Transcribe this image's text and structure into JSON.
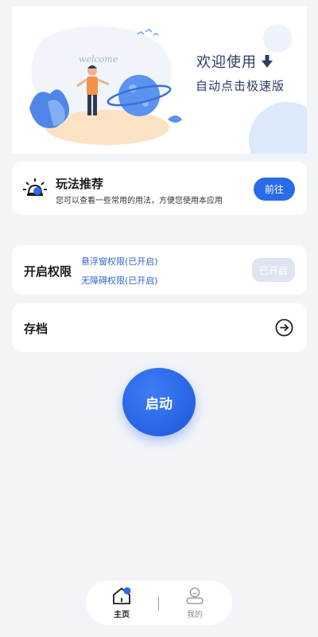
{
  "banner": {
    "welcome_text": "welcome",
    "title": "欢迎使用",
    "subtitle": "自动点击极速版",
    "title_icon": "arrow-down-icon"
  },
  "tips_card": {
    "icon": "lightbulb-icon",
    "title": "玩法推荐",
    "description": "您可以查看一些常用的用法，方便您使用本应用",
    "button_label": "前往"
  },
  "permissions_card": {
    "title": "开启权限",
    "lines": [
      "悬浮窗权限(已开启)",
      "无障碍权限(已开启)"
    ],
    "button_label": "已开启"
  },
  "archive_card": {
    "title": "存档",
    "icon": "arrow-right-circle-icon"
  },
  "start_button": {
    "label": "启动"
  },
  "bottom_nav": {
    "items": [
      {
        "label": "主页",
        "icon": "home-icon",
        "active": true
      },
      {
        "label": "我的",
        "icon": "profile-icon",
        "active": false
      }
    ]
  },
  "colors": {
    "accent": "#2b6ae8",
    "background": "#f3f4f8",
    "link_text": "#2f66c7",
    "disabled_button": "#dee5f0"
  }
}
